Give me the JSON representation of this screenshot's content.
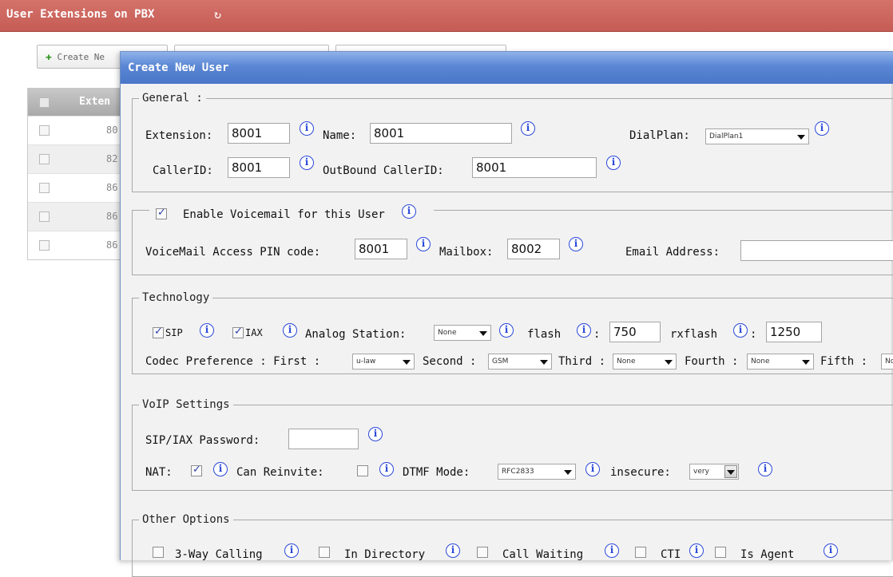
{
  "page": {
    "title": "User Extensions on PBX",
    "create_button": "Create Ne"
  },
  "table": {
    "header": "Exten",
    "rows": [
      "80(",
      "82(",
      "86",
      "86(",
      "86("
    ]
  },
  "dialog": {
    "title": "Create New User",
    "general": {
      "legend": "General :",
      "extension_label": "Extension:",
      "extension_value": "8001",
      "name_label": "Name:",
      "name_value": "8001",
      "dialplan_label": "DialPlan:",
      "dialplan_value": "DialPlan1",
      "callerid_label": "CallerID:",
      "callerid_value": "8001",
      "outbound_label": "OutBound CallerID:",
      "outbound_value": "8001"
    },
    "voicemail": {
      "enable_label": "Enable Voicemail for this User",
      "enabled": true,
      "pin_label": "VoiceMail Access PIN code:",
      "pin_value": "8001",
      "mailbox_label": "Mailbox:",
      "mailbox_value": "8002",
      "email_label": "Email Address:",
      "email_value": ""
    },
    "technology": {
      "legend": "Technology",
      "sip_label": "SIP",
      "sip_checked": true,
      "iax_label": "IAX",
      "iax_checked": true,
      "analog_label": "Analog Station:",
      "analog_value": "None",
      "flash_label": "flash",
      "flash_value": "750",
      "rxflash_label": "rxflash",
      "rxflash_value": "1250",
      "colon": ":",
      "codec_label": "Codec Preference : First :",
      "codec_first": "u-law",
      "second_label": "Second :",
      "codec_second": "GSM",
      "third_label": "Third :",
      "codec_third": "None",
      "fourth_label": "Fourth :",
      "codec_fourth": "None",
      "fifth_label": "Fifth :",
      "codec_fifth": "No"
    },
    "voip": {
      "legend": "VoIP Settings",
      "password_label": "SIP/IAX Password:",
      "password_value": "",
      "nat_label": "NAT:",
      "nat_checked": true,
      "reinvite_label": "Can Reinvite:",
      "reinvite_checked": false,
      "dtmf_label": "DTMF Mode:",
      "dtmf_value": "RFC2833",
      "insecure_label": "insecure:",
      "insecure_value": "very"
    },
    "other": {
      "legend": "Other Options",
      "threeway_label": "3-Way Calling",
      "directory_label": "In Directory",
      "callwaiting_label": "Call Waiting",
      "cti_label": "CTI",
      "agent_label": "Is Agent"
    },
    "info_glyph": "i"
  },
  "icons": {
    "refresh": "refresh-icon",
    "info": "info-icon",
    "plus": "plus-icon"
  },
  "colors": {
    "header_bar": "#c55c55",
    "dialog_title_bar": "#5a86d4",
    "info_icon": "#2a48d8"
  }
}
